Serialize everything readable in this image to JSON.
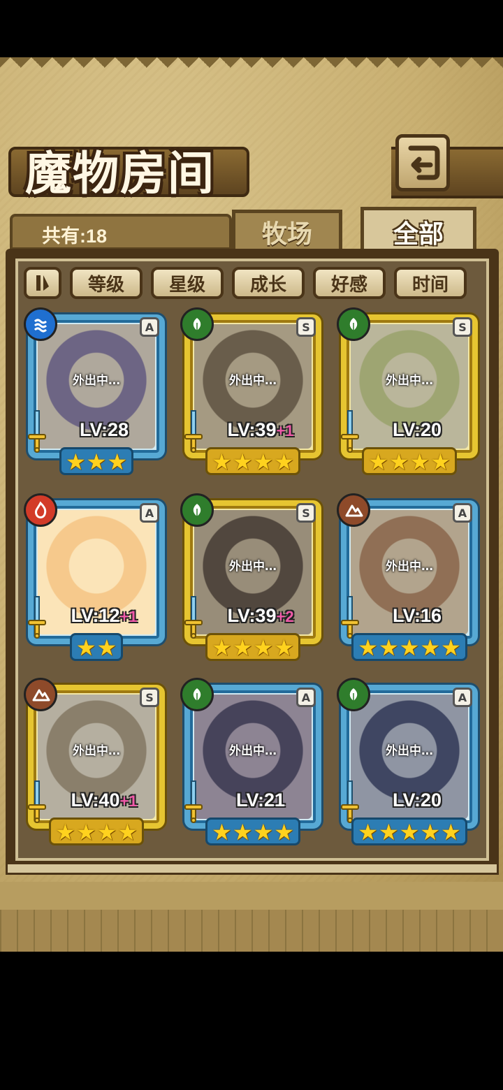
{
  "header": {
    "title": "魔物房间",
    "back_icon": "return-arrow-icon"
  },
  "count_label": "共有:18",
  "tabs": [
    {
      "label": "牧场",
      "selected": false
    },
    {
      "label": "全部",
      "selected": true
    }
  ],
  "filters": [
    {
      "label": "等级"
    },
    {
      "label": "星级"
    },
    {
      "label": "成长"
    },
    {
      "label": "好感"
    },
    {
      "label": "时间"
    }
  ],
  "sort_icon": "sort-toggle-icon",
  "colors": {
    "blue_frame": "#57a9d4",
    "gold_frame": "#e6c531",
    "level_bonus": "#f05aa8"
  },
  "cards": [
    {
      "element": "water",
      "rank": "A",
      "level": "LV:28",
      "bonus": "",
      "stars": 3,
      "away": "外出中…",
      "frame": "blue"
    },
    {
      "element": "grass",
      "rank": "S",
      "level": "LV:39",
      "bonus": "+1",
      "stars": 4,
      "away": "外出中…",
      "frame": "gold"
    },
    {
      "element": "grass",
      "rank": "S",
      "level": "LV:20",
      "bonus": "",
      "stars": 4,
      "away": "外出中…",
      "frame": "gold"
    },
    {
      "element": "fire",
      "rank": "A",
      "level": "LV:12",
      "bonus": "+1",
      "stars": 2,
      "away": "",
      "frame": "blue"
    },
    {
      "element": "grass",
      "rank": "S",
      "level": "LV:39",
      "bonus": "+2",
      "stars": 4,
      "away": "外出中…",
      "frame": "gold"
    },
    {
      "element": "earth",
      "rank": "A",
      "level": "LV:16",
      "bonus": "",
      "stars": 5,
      "away": "外出中…",
      "frame": "blue"
    },
    {
      "element": "earth",
      "rank": "S",
      "level": "LV:40",
      "bonus": "+1",
      "stars": 4,
      "away": "外出中…",
      "frame": "gold"
    },
    {
      "element": "grass",
      "rank": "A",
      "level": "LV:21",
      "bonus": "",
      "stars": 4,
      "away": "外出中…",
      "frame": "blue"
    },
    {
      "element": "grass",
      "rank": "A",
      "level": "LV:20",
      "bonus": "",
      "stars": 5,
      "away": "外出中…",
      "frame": "blue"
    }
  ]
}
